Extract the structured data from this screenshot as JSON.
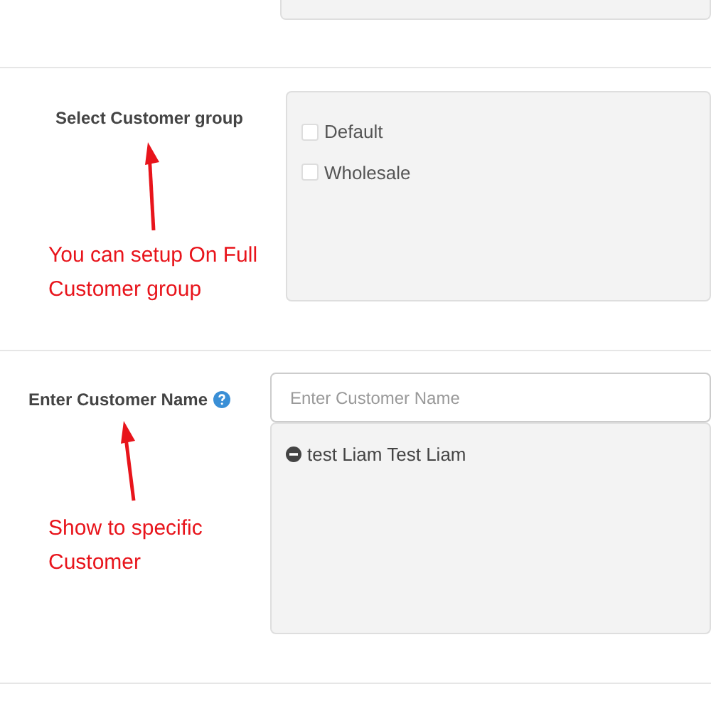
{
  "customer_group": {
    "label": "Select Customer group",
    "options": [
      {
        "label": "Default",
        "checked": false
      },
      {
        "label": "Wholesale",
        "checked": false
      }
    ],
    "note": "You can setup On Full Customer group"
  },
  "customer_name": {
    "label": "Enter Customer Name",
    "placeholder": "Enter Customer Name",
    "selected": [
      "test Liam Test Liam"
    ],
    "note": "Show to specific Customer"
  }
}
